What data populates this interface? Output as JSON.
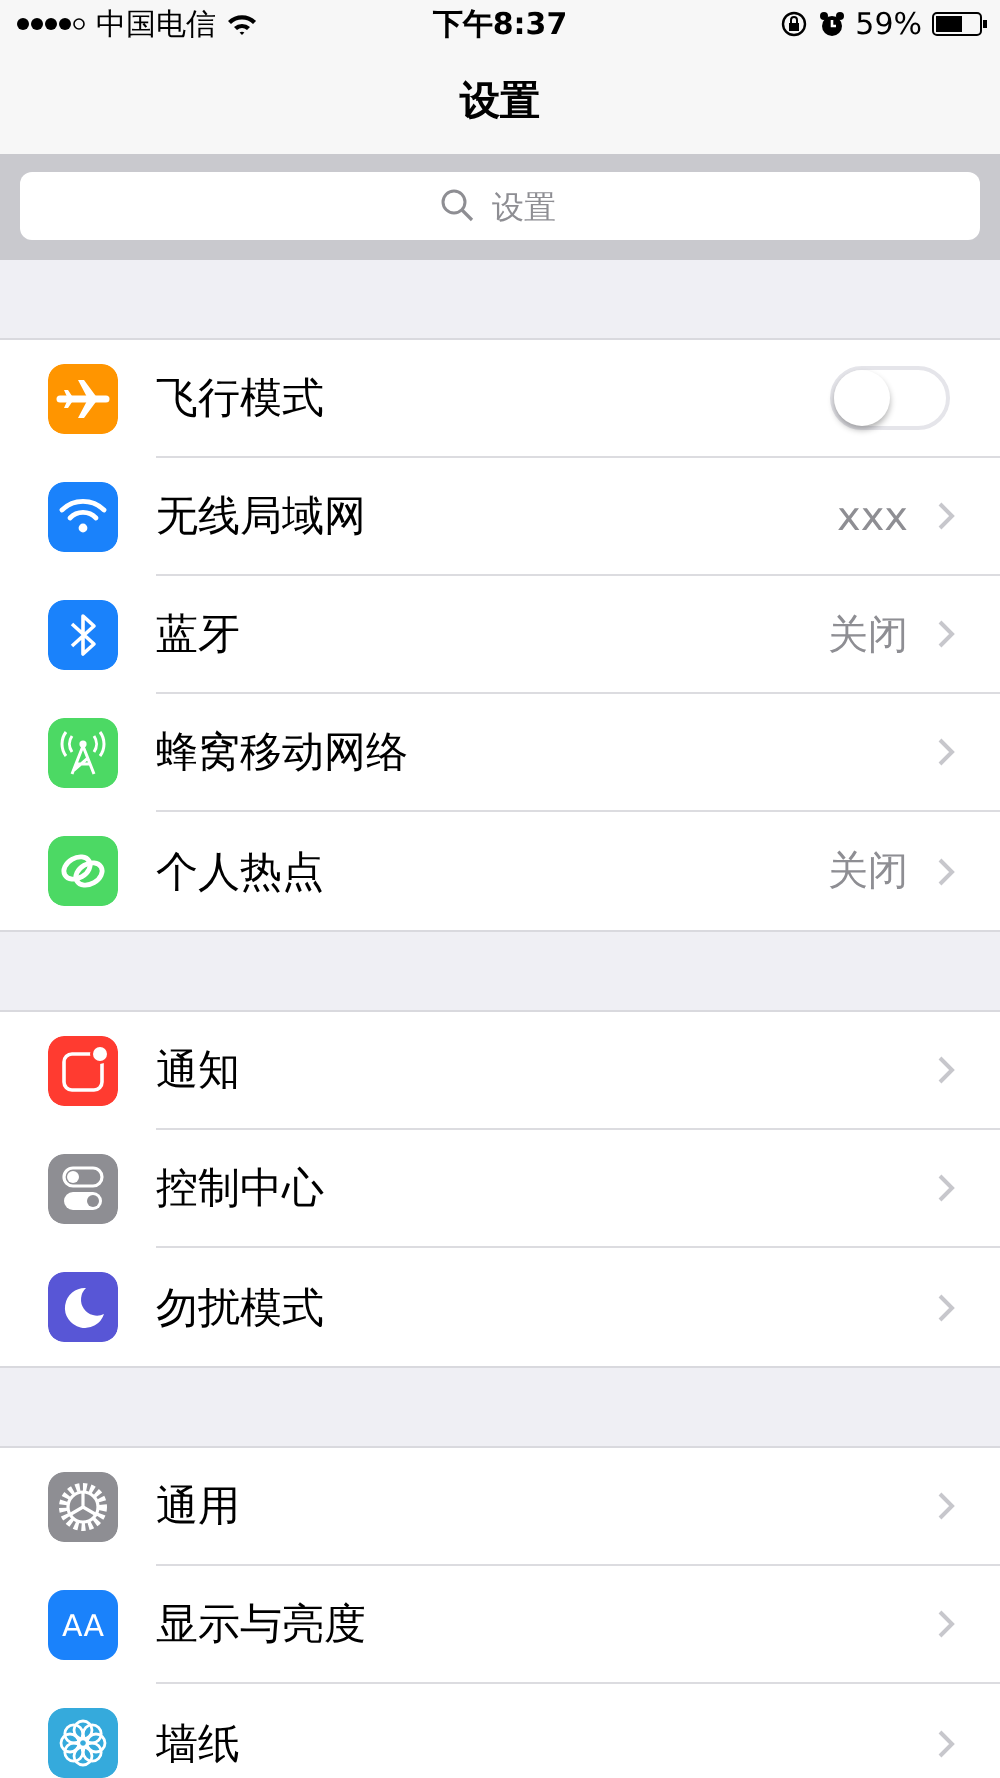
{
  "status_bar": {
    "carrier": "中国电信",
    "time": "下午8:37",
    "battery": "59%"
  },
  "nav": {
    "title": "设置"
  },
  "search": {
    "placeholder": "设置"
  },
  "sections": [
    {
      "rows": [
        {
          "kind": "toggle",
          "label": "飞行模式",
          "color": "#ff9500",
          "on": false
        },
        {
          "kind": "link",
          "label": "无线局域网",
          "value": "xxx",
          "color": "#1a82fb"
        },
        {
          "kind": "link",
          "label": "蓝牙",
          "value": "关闭",
          "color": "#1a82fb"
        },
        {
          "kind": "link",
          "label": "蜂窝移动网络",
          "color": "#4cd964"
        },
        {
          "kind": "link",
          "label": "个人热点",
          "value": "关闭",
          "color": "#4cd964"
        }
      ]
    },
    {
      "rows": [
        {
          "kind": "link",
          "label": "通知",
          "color": "#ff3b30"
        },
        {
          "kind": "link",
          "label": "控制中心",
          "color": "#8e8e93"
        },
        {
          "kind": "link",
          "label": "勿扰模式",
          "color": "#5856d6"
        }
      ]
    },
    {
      "rows": [
        {
          "kind": "link",
          "label": "通用",
          "color": "#8e8e93"
        },
        {
          "kind": "link",
          "label": "显示与亮度",
          "color": "#1a82fb",
          "glyph": "AA"
        },
        {
          "kind": "link",
          "label": "墙纸",
          "color": "#35aadc"
        }
      ]
    }
  ]
}
